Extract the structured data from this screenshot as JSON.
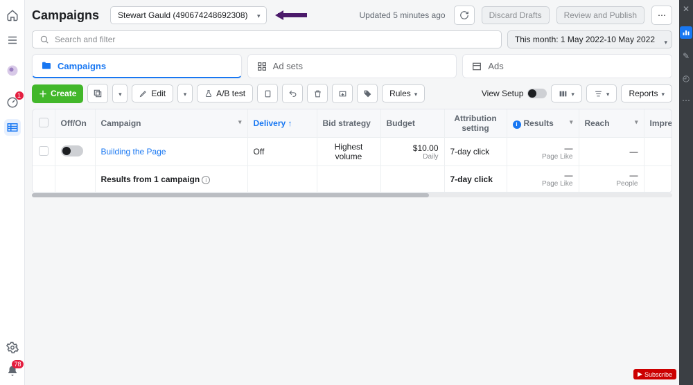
{
  "header": {
    "title": "Campaigns",
    "account": "Stewart Gauld (490674248692308)",
    "updated": "Updated 5 minutes ago",
    "discard": "Discard Drafts",
    "review": "Review and Publish"
  },
  "search": {
    "placeholder": "Search and filter",
    "date_range": "This month: 1 May 2022-10 May 2022"
  },
  "tabs": {
    "campaigns": "Campaigns",
    "adsets": "Ad sets",
    "ads": "Ads"
  },
  "toolbar": {
    "create": "Create",
    "edit": "Edit",
    "abtest": "A/B test",
    "rules": "Rules",
    "view_setup": "View Setup",
    "reports": "Reports"
  },
  "table": {
    "headers": {
      "offon": "Off/On",
      "campaign": "Campaign",
      "delivery": "Delivery",
      "bid": "Bid strategy",
      "budget": "Budget",
      "attribution": "Attribution setting",
      "results": "Results",
      "reach": "Reach",
      "impressions": "Impres"
    },
    "row": {
      "name": "Building the Page",
      "delivery": "Off",
      "bid": "Highest volume",
      "budget": "$10.00",
      "budget_sub": "Daily",
      "attribution": "7-day click",
      "results": "—",
      "results_sub": "Page Like",
      "reach": "—"
    },
    "summary": {
      "label": "Results from 1 campaign",
      "attribution": "7-day click",
      "results": "—",
      "results_sub": "Page Like",
      "reach": "—",
      "reach_sub": "People"
    }
  },
  "left_rail": {
    "badge1": "1",
    "badge2": "78"
  },
  "subscribe": "Subscribe"
}
